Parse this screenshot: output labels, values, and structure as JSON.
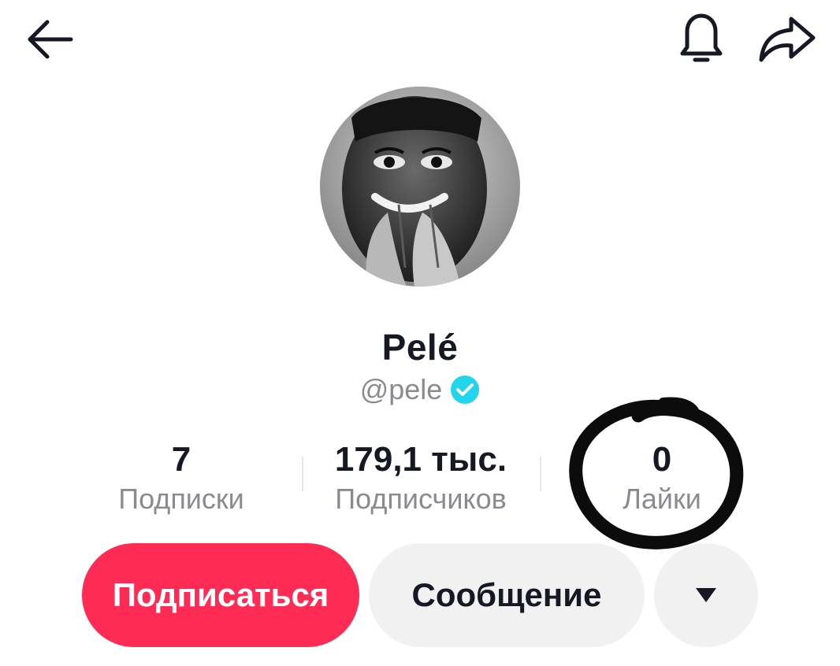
{
  "header": {
    "back_icon": "arrow-left-icon",
    "bell_icon": "bell-icon",
    "share_icon": "share-arrow-icon"
  },
  "profile": {
    "name": "Pelé",
    "handle": "@pele",
    "verified_icon": "verified-check-icon",
    "verified_color": "#20d5ec"
  },
  "stats": {
    "following": {
      "value": "7",
      "label": "Подписки"
    },
    "followers": {
      "value": "179,1 тыс.",
      "label": "Подписчиков"
    },
    "likes": {
      "value": "0",
      "label": "Лайки"
    }
  },
  "actions": {
    "follow_label": "Подписаться",
    "message_label": "Сообщение",
    "more_icon": "caret-down-icon"
  },
  "colors": {
    "accent": "#fe2c55",
    "text_primary": "#161823",
    "text_secondary": "#8a8b91",
    "button_secondary_bg": "#f1f1f2"
  }
}
